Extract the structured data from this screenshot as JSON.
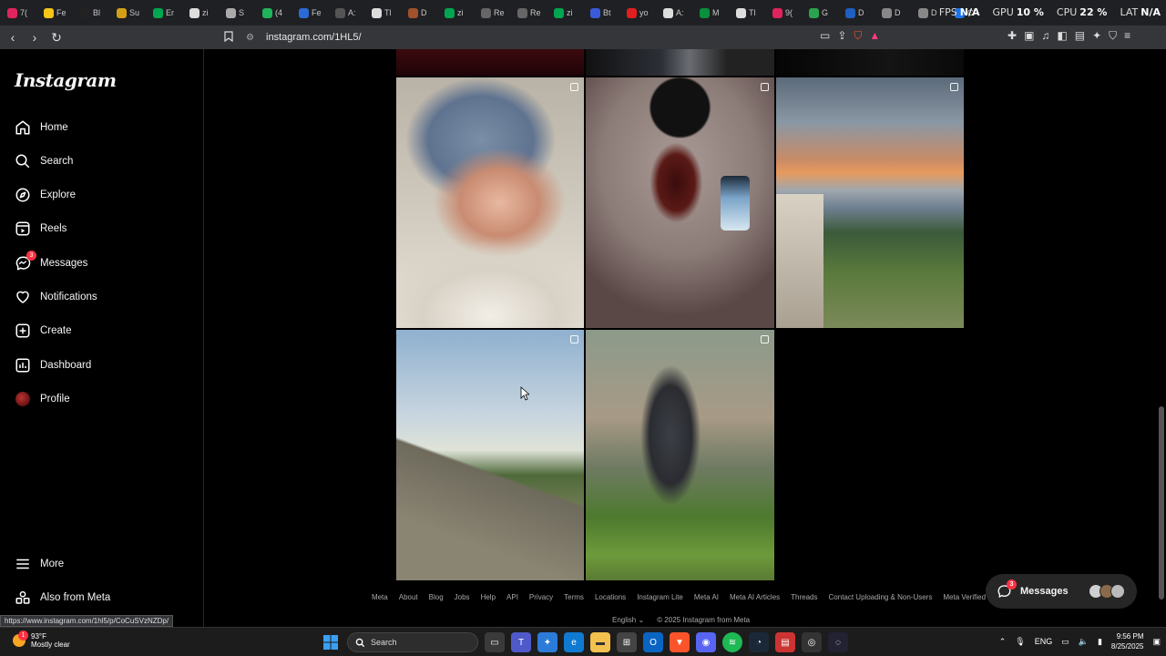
{
  "browser": {
    "tabs": [
      {
        "label": "7(",
        "color": "#e0245e"
      },
      {
        "label": "Fe",
        "color": "#f5c518"
      },
      {
        "label": "Bl",
        "color": "#222"
      },
      {
        "label": "Su",
        "color": "#d4a017"
      },
      {
        "label": "Er",
        "color": "#00a650"
      },
      {
        "label": "zi",
        "color": "#ddd"
      },
      {
        "label": "S",
        "color": "#aaa"
      },
      {
        "label": "(4",
        "color": "#1fb35a"
      },
      {
        "label": "Fe",
        "color": "#2b6bd6"
      },
      {
        "label": "A:",
        "color": "#555"
      },
      {
        "label": "Tl",
        "color": "#ddd"
      },
      {
        "label": "D",
        "color": "#a0522d"
      },
      {
        "label": "zi",
        "color": "#00a650"
      },
      {
        "label": "Re",
        "color": "#666"
      },
      {
        "label": "Re",
        "color": "#666"
      },
      {
        "label": "zi",
        "color": "#00a650"
      },
      {
        "label": "Bt",
        "color": "#3a5bd9"
      },
      {
        "label": "yo",
        "color": "#e02020"
      },
      {
        "label": "A:",
        "color": "#ddd"
      },
      {
        "label": "M",
        "color": "#0a8f3c"
      },
      {
        "label": "Tl",
        "color": "#ddd"
      },
      {
        "label": "9(",
        "color": "#e0245e"
      },
      {
        "label": "G",
        "color": "#2aa44f"
      },
      {
        "label": "D",
        "color": "#1f5fbf"
      },
      {
        "label": "D",
        "color": "#888"
      },
      {
        "label": "D",
        "color": "#888"
      },
      {
        "label": "C",
        "color": "#1a73e8"
      }
    ],
    "overlay": {
      "fps_label": "FPS",
      "fps_value": "N/A",
      "gpu_label": "GPU",
      "gpu_value": "10 %",
      "cpu_label": "CPU",
      "cpu_value": "22 %",
      "lat_label": "LAT",
      "lat_value": "N/A"
    },
    "url": "instagram.com/1HL5/",
    "status_link": "https://www.instagram.com/1hl5/p/CoCuSVzNZDp/"
  },
  "sidebar": {
    "logo": "Instagram",
    "items": [
      {
        "label": "Home",
        "icon": "home-icon"
      },
      {
        "label": "Search",
        "icon": "search-icon"
      },
      {
        "label": "Explore",
        "icon": "compass-icon"
      },
      {
        "label": "Reels",
        "icon": "reels-icon"
      },
      {
        "label": "Messages",
        "icon": "messenger-icon",
        "badge": "3"
      },
      {
        "label": "Notifications",
        "icon": "heart-icon"
      },
      {
        "label": "Create",
        "icon": "plus-square-icon"
      },
      {
        "label": "Dashboard",
        "icon": "bar-chart-icon"
      },
      {
        "label": "Profile",
        "icon": "avatar"
      }
    ],
    "more": "More",
    "also_from_meta": "Also from Meta"
  },
  "footer": {
    "links": [
      "Meta",
      "About",
      "Blog",
      "Jobs",
      "Help",
      "API",
      "Privacy",
      "Terms",
      "Locations",
      "Instagram Lite",
      "Meta AI",
      "Meta AI Articles",
      "Threads",
      "Contact Uploading & Non-Users",
      "Meta Verified"
    ],
    "language": "English",
    "copyright": "© 2025 Instagram from Meta"
  },
  "messages_pill": {
    "label": "Messages",
    "badge": "3"
  },
  "taskbar": {
    "temperature": "93°F",
    "weather": "Mostly clear",
    "weather_badge": "1",
    "search_placeholder": "Search",
    "language": "ENG",
    "time": "9:56 PM",
    "date": "8/25/2025"
  }
}
